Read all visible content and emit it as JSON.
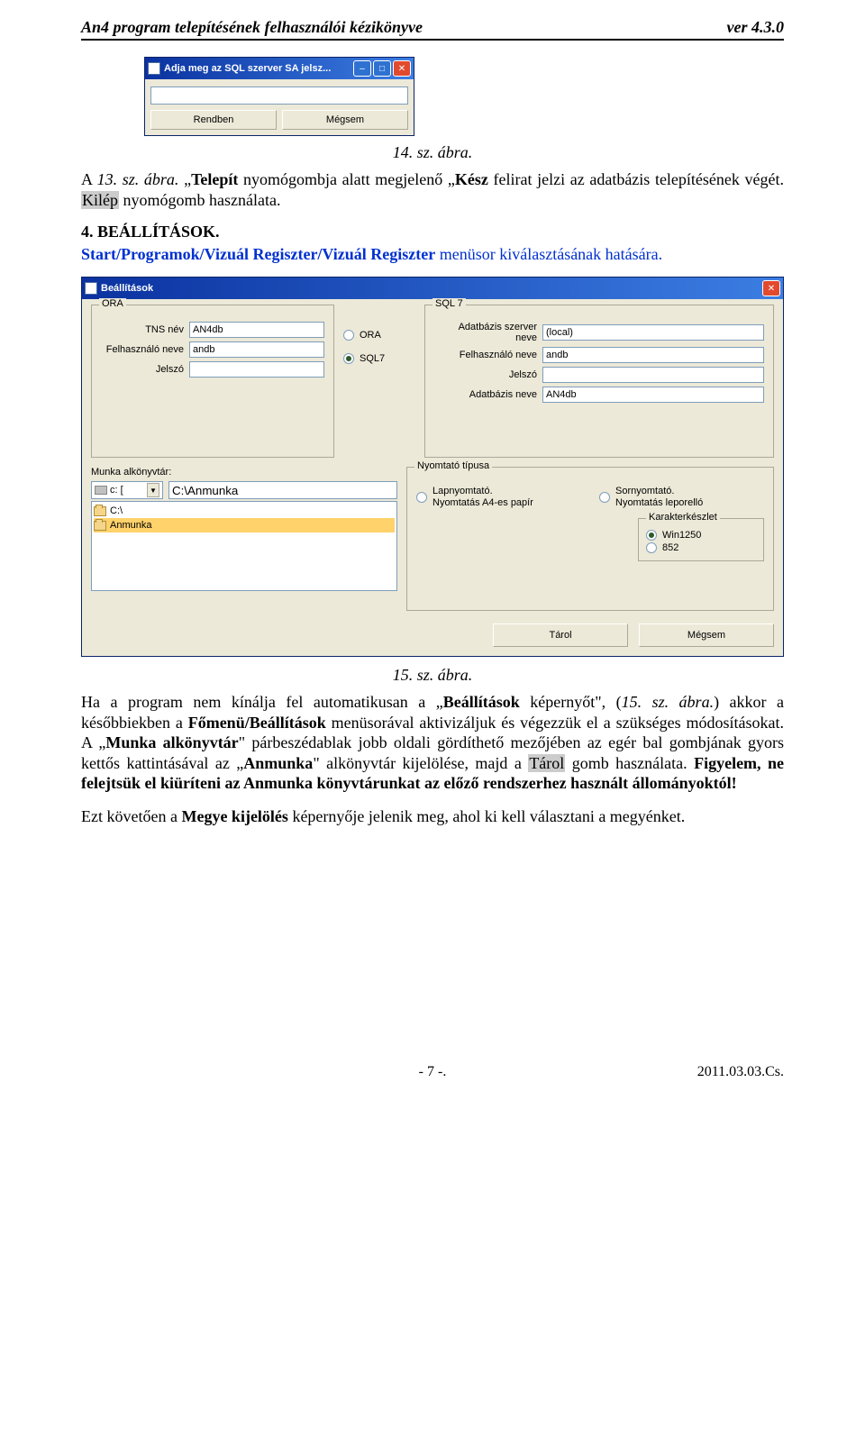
{
  "header": {
    "title": "An4 program telepítésének felhasználói kézikönyve",
    "version": "ver 4.3.0"
  },
  "dlg_small": {
    "title": "Adja meg az SQL szerver SA jelsz...",
    "input_value": "",
    "ok_label": "Rendben",
    "cancel_label": "Mégsem"
  },
  "caption14": "14. sz. ábra.",
  "para1_a": "A ",
  "para1_b": "13. sz. ábra.",
  "para1_c": " „",
  "para1_d": "Telepít",
  "para1_e": " nyomógombja alatt megjelenő „",
  "para1_f": "Kész",
  "para1_g": " felirat jelzi az adatbázis telepítésének végét. ",
  "para1_h": "Kilép",
  "para1_i": " nyomógomb használata.",
  "section4": "4. BEÁLLÍTÁSOK.",
  "linkline_a": "Start/Programok/Vizuál Regiszter/Vizuál Regiszter",
  "linkline_b": " menüsor kiválasztásának hatására.",
  "dlg_big": {
    "title": "Beállítások",
    "ora": {
      "legend": "ORA",
      "tns_label": "TNS név",
      "tns_value": "AN4db",
      "user_label": "Felhasználó neve",
      "user_value": "andb",
      "pw_label": "Jelszó",
      "pw_value": ""
    },
    "dbtype": {
      "ora": "ORA",
      "sql7": "SQL7"
    },
    "sql": {
      "legend": "SQL 7",
      "server_label": "Adatbázis szerver neve",
      "server_value": "(local)",
      "user_label": "Felhasználó neve",
      "user_value": "andb",
      "pw_label": "Jelszó",
      "pw_value": "",
      "db_label": "Adatbázis neve",
      "db_value": "AN4db"
    },
    "work": {
      "label": "Munka alkönyvtár:",
      "drive": "c: [",
      "path": "C:\\Anmunka",
      "item_root": "C:\\",
      "item_sel": "Anmunka"
    },
    "printer": {
      "legend": "Nyomtató típusa",
      "page_line1": "Lapnyomtató.",
      "page_line2": "Nyomtatás A4-es papír",
      "line_line1": "Sornyomtató.",
      "line_line2": "Nyomtatás leporelló",
      "charset_legend": "Karakterkészlet",
      "cs1": "Win1250",
      "cs2": "852"
    },
    "save_label": "Tárol",
    "cancel_label": "Mégsem"
  },
  "caption15": "15. sz. ábra.",
  "para2_a": "Ha a program nem kínálja fel automatikusan a „",
  "para2_b": "Beállítások",
  "para2_c": " képernyőt\", (",
  "para2_d": "15. sz. ábra.",
  "para2_e": ") akkor a későbbiekben a ",
  "para2_f": "Főmenü/Beállítások",
  "para2_g": " menüsorával aktivizáljuk és végezzük el a szükséges módosításokat. A „",
  "para2_h": "Munka alkönyvtár",
  "para2_i": "\" párbeszédablak jobb oldali gördíthető mezőjében az egér bal gombjának gyors kettős kattintásával az „",
  "para2_j": "Anmunka",
  "para2_k": "\" alkönyvtár kijelölése, majd a ",
  "para2_l": "Tárol",
  "para2_m": " gomb használata. ",
  "para2_n": "Figyelem, ne felejtsük el kiüríteni az Anmunka könyvtárunkat az előző rendszerhez használt állományoktól!",
  "para3_a": "Ezt követően a ",
  "para3_b": "Megye kijelölés",
  "para3_c": " képernyője jelenik meg, ahol ki kell választani a megyénket.",
  "footer": {
    "page": "- 7 -.",
    "date": "2011.03.03.Cs."
  }
}
